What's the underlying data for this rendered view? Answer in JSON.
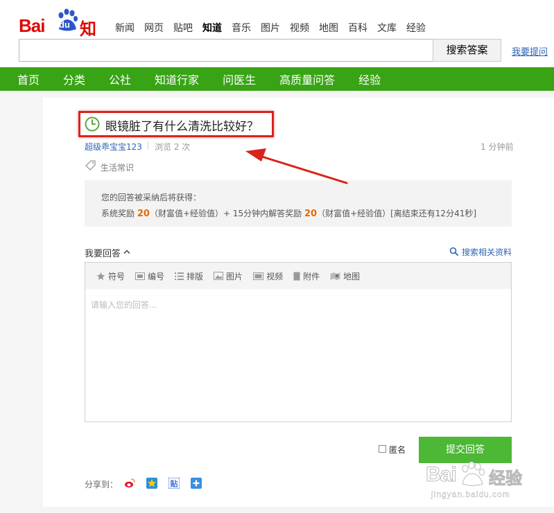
{
  "logo": {
    "bai": "Bai",
    "du": "du",
    "zhidao": "知道"
  },
  "topnav": [
    "新闻",
    "网页",
    "贴吧",
    "知道",
    "音乐",
    "图片",
    "视频",
    "地图",
    "百科",
    "文库",
    "经验"
  ],
  "topnav_active": "知道",
  "search": {
    "button_label": "搜索答案",
    "ask_link": "我要提问",
    "value": ""
  },
  "greennav": [
    "首页",
    "分类",
    "公社",
    "知道行家",
    "问医生",
    "高质量问答",
    "经验"
  ],
  "question": {
    "title": "眼镜脏了有什么清洗比较好？",
    "asker": "超级乖宝宝123",
    "views": "浏览 2 次",
    "time": "1 分钟前",
    "tag": "生活常识"
  },
  "reward": {
    "line1": "您的回答被采纳后将获得：",
    "system_label": "系统奖励",
    "system_points": "20",
    "system_unit": "（财富值+经验值）+ 15分钟内解答奖励",
    "bonus_points": "20",
    "bonus_unit": "（财富值+经验值）[离结束还有12分41秒]"
  },
  "answer": {
    "header": "我要回答",
    "search_related": "搜索相关资料",
    "toolbar": [
      "符号",
      "编号",
      "排版",
      "图片",
      "视频",
      "附件",
      "地图"
    ],
    "placeholder": "请输入您的回答...",
    "anonymous_label": "匿名",
    "submit_label": "提交回答"
  },
  "share": {
    "label": "分享到："
  },
  "watermark": {
    "bai": "Bai",
    "jingyan": "经验",
    "url": "jingyan.baidu.com"
  },
  "colors": {
    "brand_red": "#e10601",
    "nav_green": "#38a415",
    "submit_green": "#4cb835",
    "link_blue": "#2d64b3",
    "highlight_red": "#d9231b",
    "reward_orange": "#e66b00"
  }
}
